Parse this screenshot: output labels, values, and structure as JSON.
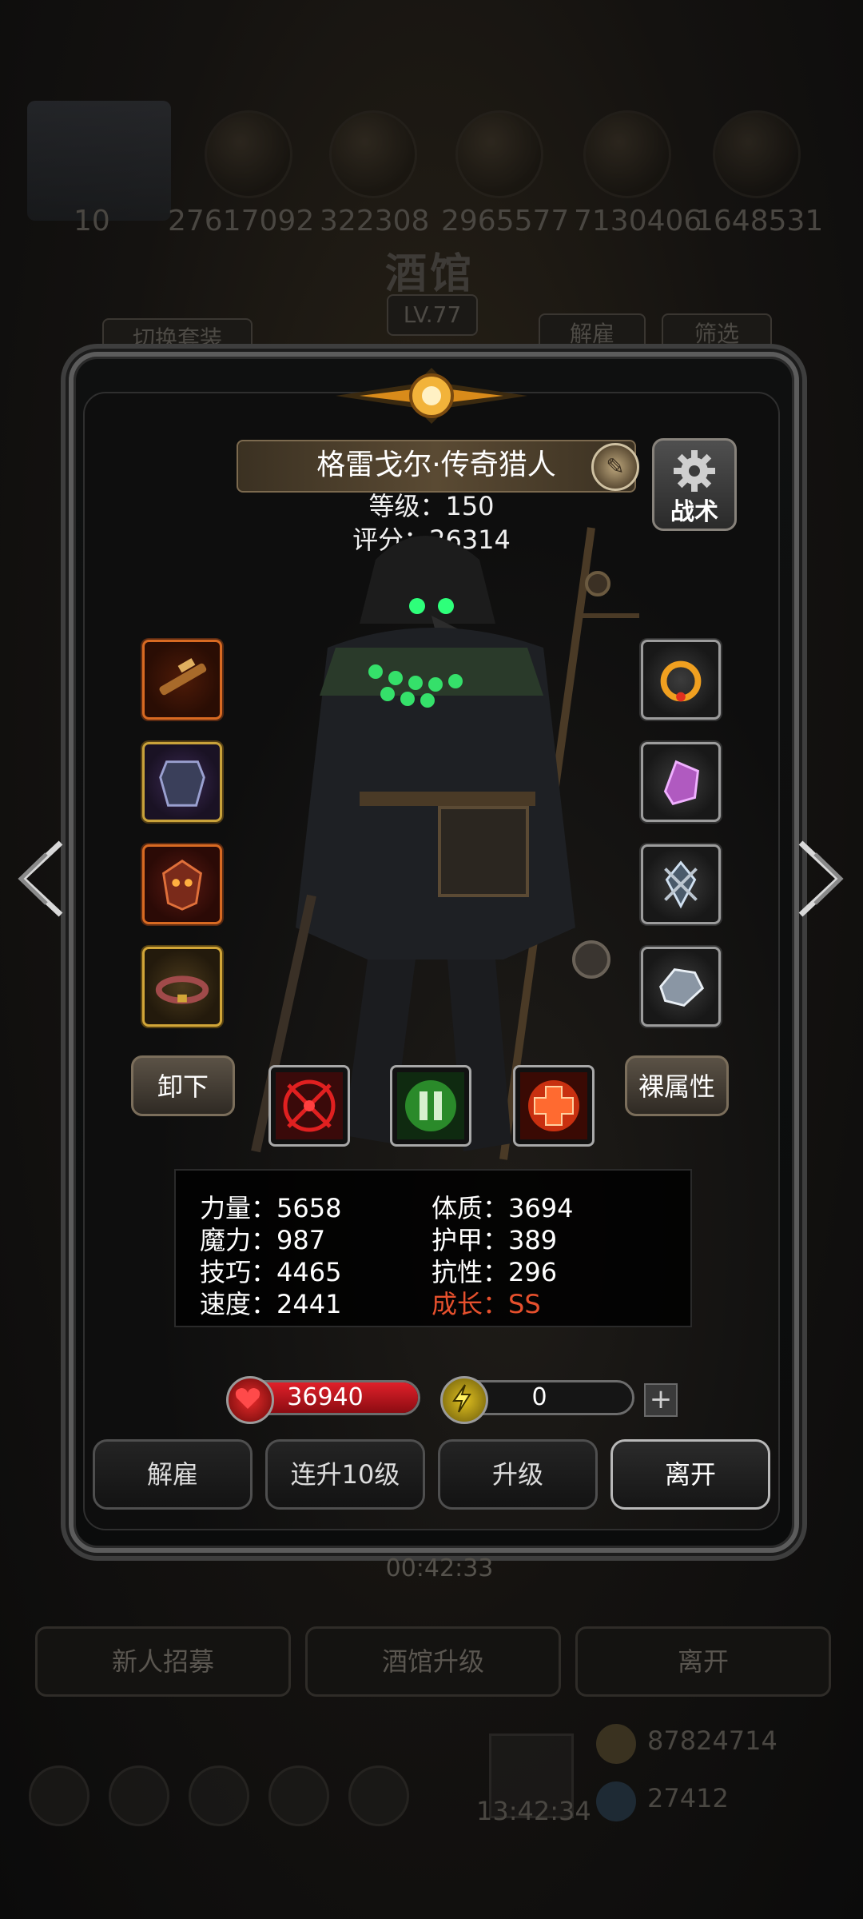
{
  "background": {
    "title": "酒馆",
    "level": "LV.77",
    "top_numbers": [
      "10",
      "27617092",
      "322308",
      "2965577",
      "7130406",
      "1648531"
    ],
    "switch_outfit": "切换套装",
    "dismiss": "解雇",
    "filter": "筛选",
    "timer": "00:42:33",
    "bottom_buttons": [
      "新人招募",
      "酒馆升级",
      "离开"
    ],
    "gold": "87824714",
    "gems": "27412",
    "clock": "13:42:34"
  },
  "hero": {
    "name": "格雷戈尔·传奇猎人",
    "level_label": "等级：150",
    "score_label": "评分：26314",
    "tactics_label": "战术"
  },
  "equipment": {
    "left": [
      {
        "icon": "flintlock-weapon-icon",
        "rarity": "orange"
      },
      {
        "icon": "dark-armor-icon",
        "rarity": "purple"
      },
      {
        "icon": "demon-mask-icon",
        "rarity": "red"
      },
      {
        "icon": "belt-icon",
        "rarity": "gold"
      }
    ],
    "right": [
      {
        "icon": "fire-ring-icon",
        "rarity": "gray"
      },
      {
        "icon": "crystal-icon",
        "rarity": "gray"
      },
      {
        "icon": "emblem-icon",
        "rarity": "gray"
      },
      {
        "icon": "diamond-icon",
        "rarity": "gray"
      }
    ]
  },
  "actions": {
    "unequip": "卸下",
    "base_attributes": "裸属性"
  },
  "skills": [
    "crosshair-skill-icon",
    "poison-skill-icon",
    "heal-cross-skill-icon"
  ],
  "stats": {
    "strength": "力量：5658",
    "magic": "魔力：987",
    "skill": "技巧：4465",
    "speed": "速度：2441",
    "constitution": "体质：3694",
    "armor": "护甲：389",
    "resistance": "抗性：296",
    "growth": "成长：SS"
  },
  "bars": {
    "hp": "36940",
    "energy": "0",
    "plus": "+"
  },
  "modal_buttons": [
    "解雇",
    "连升10级",
    "升级",
    "离开"
  ],
  "colors": {
    "growth": "#e6502d",
    "hp_bar": "#c4121a",
    "frame": "#5c5c5c"
  }
}
